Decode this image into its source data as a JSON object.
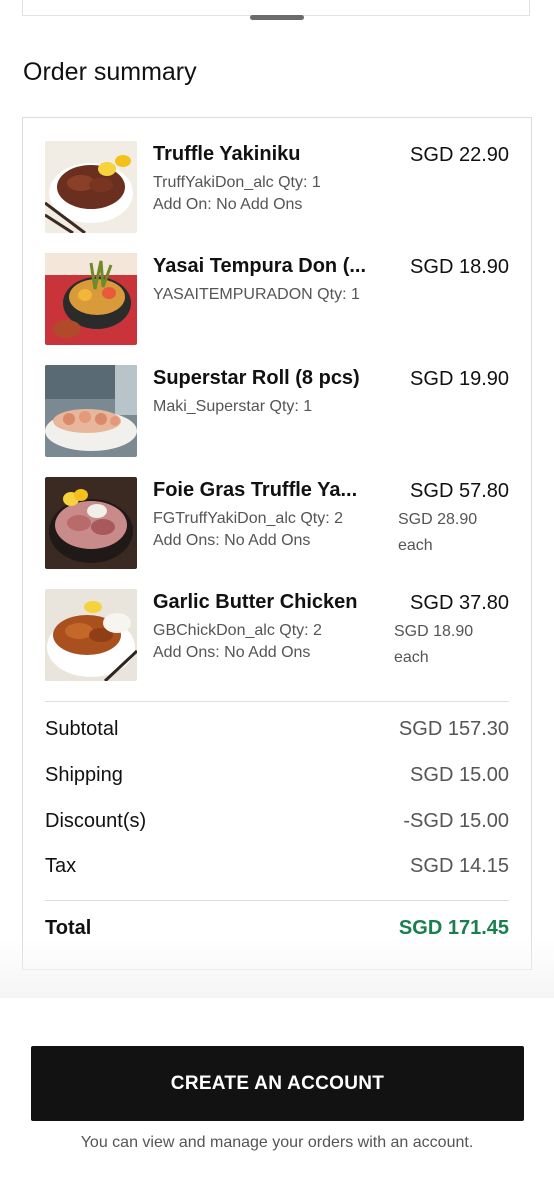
{
  "summary": {
    "heading": "Order summary"
  },
  "items": [
    {
      "name": "Truffle Yakiniku",
      "detail": "TruffYakiDon_alc Qty: 1",
      "addons": "Add On: No Add Ons",
      "price": "SGD 22.90",
      "each": ""
    },
    {
      "name": "Yasai Tempura Don (...",
      "detail": "YASAITEMPURADON Qty: 1",
      "addons": "",
      "price": "SGD 18.90",
      "each": ""
    },
    {
      "name": "Superstar Roll (8 pcs)",
      "detail": "Maki_Superstar Qty: 1",
      "addons": "",
      "price": "SGD 19.90",
      "each": ""
    },
    {
      "name": "Foie Gras Truffle Ya...",
      "detail": "FGTruffYakiDon_alc Qty: 2",
      "addons": "Add Ons: No Add Ons",
      "price": "SGD 57.80",
      "each_price": "SGD 28.90",
      "each_label": "each"
    },
    {
      "name": "Garlic Butter Chicken",
      "detail": "GBChickDon_alc Qty: 2",
      "addons": "Add Ons: No Add Ons",
      "price": "SGD 37.80",
      "each_price": "SGD 18.90",
      "each_label": "each"
    }
  ],
  "totals": {
    "subtotal_label": "Subtotal",
    "subtotal_value": "SGD 157.30",
    "shipping_label": "Shipping",
    "shipping_value": "SGD 15.00",
    "discount_label": "Discount(s)",
    "discount_value": "-SGD 15.00",
    "tax_label": "Tax",
    "tax_value": "SGD 14.15",
    "total_label": "Total",
    "total_value": "SGD 171.45"
  },
  "footer": {
    "cta_label": "CREATE AN ACCOUNT",
    "note": "You can view and manage your orders with an account."
  },
  "colors": {
    "total_green": "#1a7f4e",
    "cta_bg": "#121212"
  },
  "icons": [
    "drag-handle-icon"
  ]
}
